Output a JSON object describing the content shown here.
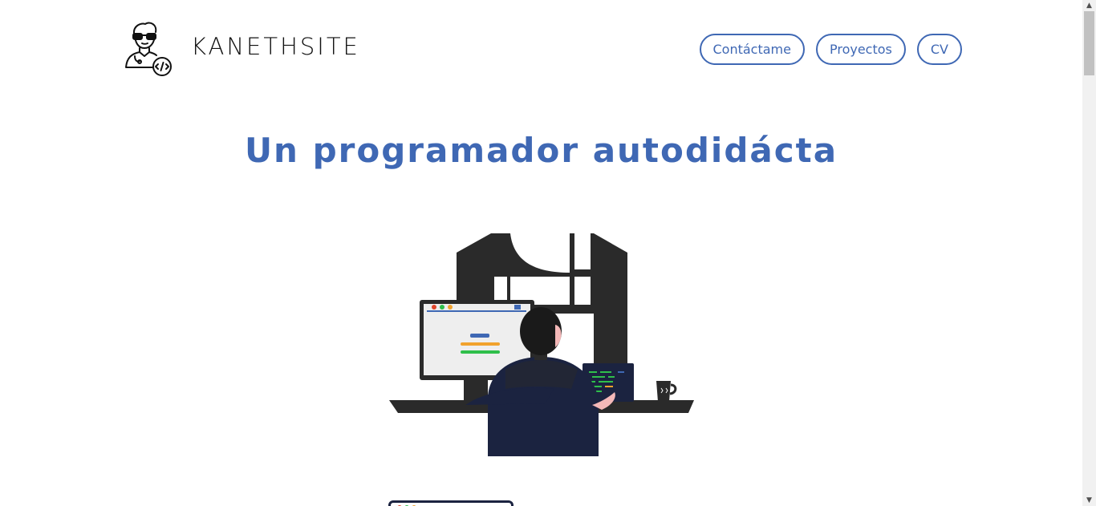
{
  "header": {
    "brand": "KANETHSITE",
    "nav": [
      {
        "label": "Contáctame"
      },
      {
        "label": "Proyectos"
      },
      {
        "label": "CV"
      }
    ]
  },
  "hero": {
    "title": "Un programador autodidácta"
  },
  "icons": {
    "logo": "programmer-avatar-icon",
    "illustration": "programmer-at-desk-illustration"
  },
  "colors": {
    "accent": "#3f68b4",
    "text_dark": "#111111",
    "illustration_dark": "#2a2a2a",
    "illustration_navy": "#1b2340"
  }
}
